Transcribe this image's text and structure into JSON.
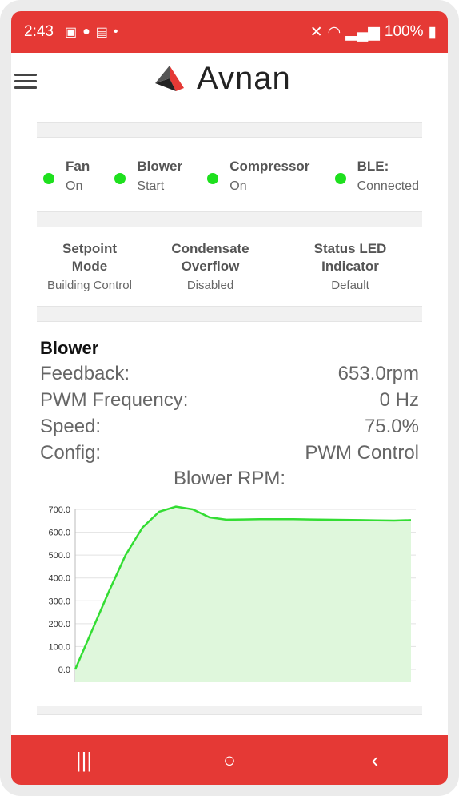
{
  "statusbar": {
    "time": "2:43",
    "battery": "100%",
    "icons": [
      "image-icon",
      "bulb-icon",
      "calendar-icon",
      "dot-icon"
    ],
    "right_icons": [
      "mute-icon",
      "wifi-icon",
      "signal-icon",
      "battery-icon"
    ]
  },
  "app": {
    "logo_text": "Avnan",
    "menu_icon": "hamburger-icon"
  },
  "status_items": [
    {
      "name": "Fan",
      "value": "On",
      "color": "#1ee01e"
    },
    {
      "name": "Blower",
      "value": "Start",
      "color": "#1ee01e"
    },
    {
      "name": "Compressor",
      "value": "On",
      "color": "#1ee01e"
    },
    {
      "name": "BLE:",
      "value": "Connected",
      "color": "#1ee01e"
    }
  ],
  "settings": [
    {
      "name": "Setpoint Mode",
      "value": "Building Control"
    },
    {
      "name": "Condensate Overflow",
      "value": "Disabled"
    },
    {
      "name": "Status LED Indicator",
      "value": "Default"
    }
  ],
  "blower": {
    "title": "Blower",
    "rows": [
      {
        "label": "Feedback:",
        "value": "653.0rpm"
      },
      {
        "label": "PWM Frequency:",
        "value": "0 Hz"
      },
      {
        "label": "Speed:",
        "value": "75.0%"
      },
      {
        "label": "Config:",
        "value": "PWM Control"
      }
    ],
    "chart_title": "Blower RPM:"
  },
  "chart_data": {
    "type": "area",
    "title": "Blower RPM:",
    "xlabel": "",
    "ylabel": "",
    "ylim": [
      0,
      700
    ],
    "yticks": [
      "0.0",
      "100.0",
      "200.0",
      "300.0",
      "400.0",
      "500.0",
      "600.0",
      "700.0"
    ],
    "grid": true,
    "line_color": "#33dd33",
    "fill_color": "#dff7dc",
    "series": [
      {
        "values": [
          0,
          170,
          340,
          500,
          620,
          690,
          712,
          700,
          665,
          655,
          656,
          657,
          657,
          657,
          656,
          655,
          654,
          653,
          652,
          651,
          653
        ]
      }
    ]
  },
  "navbar": {
    "recent": "|||",
    "home": "○",
    "back": "‹"
  }
}
